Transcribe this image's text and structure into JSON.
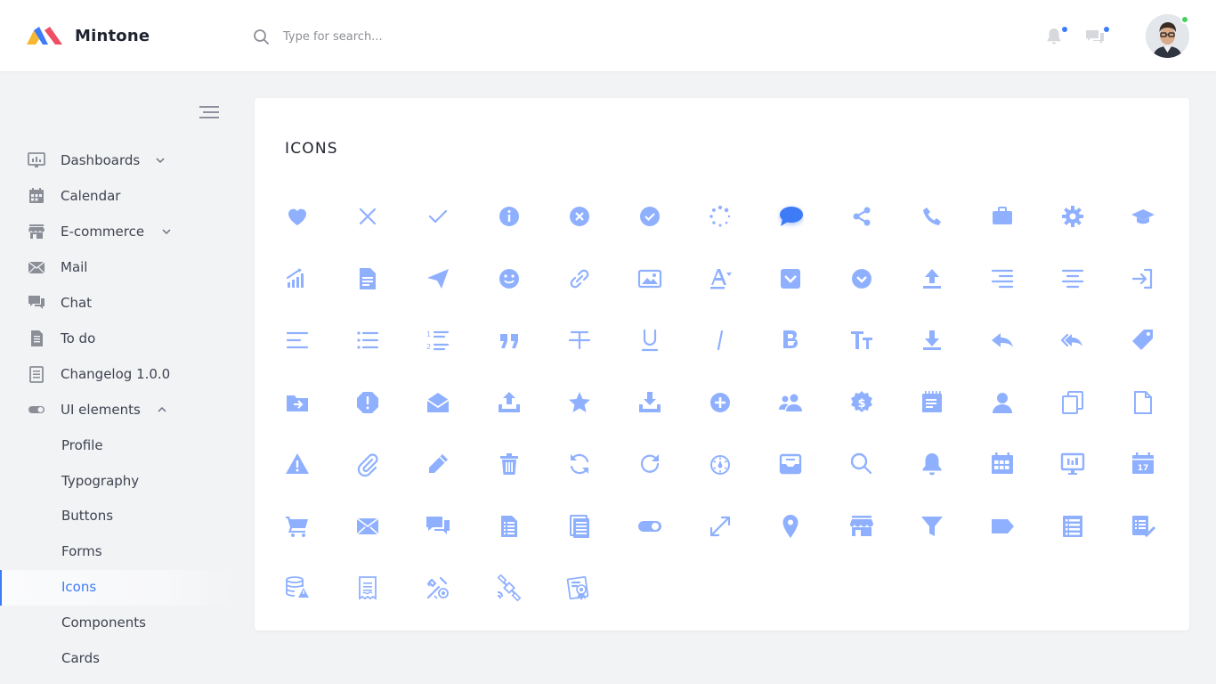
{
  "app": {
    "brand": "Mintone"
  },
  "search": {
    "placeholder": "Type for search..."
  },
  "colors": {
    "accent": "#3d7bf7",
    "icon_fill": "#8fb0ff",
    "icon_active": "#3d7bf7",
    "online": "#41d35a"
  },
  "sidebar": {
    "items": [
      {
        "label": "Dashboards",
        "icon": "dashboard-icon",
        "expandable": true
      },
      {
        "label": "Calendar",
        "icon": "calendar-icon"
      },
      {
        "label": "E-commerce",
        "icon": "store-icon",
        "expandable": true
      },
      {
        "label": "Mail",
        "icon": "mail-icon"
      },
      {
        "label": "Chat",
        "icon": "chat-icon"
      },
      {
        "label": "To do",
        "icon": "todo-icon"
      },
      {
        "label": "Changelog 1.0.0",
        "icon": "changelog-icon"
      },
      {
        "label": "UI elements",
        "icon": "toggle-icon",
        "expandable": true,
        "expanded": true
      }
    ],
    "sub_items": [
      {
        "label": "Profile"
      },
      {
        "label": "Typography"
      },
      {
        "label": "Buttons"
      },
      {
        "label": "Forms"
      },
      {
        "label": "Icons",
        "active": true
      },
      {
        "label": "Components"
      },
      {
        "label": "Cards"
      }
    ]
  },
  "main": {
    "title": "ICONS",
    "icons": [
      "heart-icon",
      "close-icon",
      "check-icon",
      "info-icon",
      "close-circle-icon",
      "check-circle-icon",
      "loading-icon",
      "comment-icon",
      "share-icon",
      "phone-icon",
      "briefcase-icon",
      "gear-icon",
      "graduation-cap-icon",
      "signal-icon",
      "document-icon",
      "send-icon",
      "smile-icon",
      "link-icon",
      "image-icon",
      "font-color-icon",
      "chevron-box-icon",
      "chevron-circle-icon",
      "upload-icon",
      "align-right-icon",
      "align-center-icon",
      "sign-in-icon",
      "align-left-icon",
      "list-icon",
      "ordered-list-icon",
      "quote-icon",
      "strikethrough-icon",
      "underline-icon",
      "italic-icon",
      "bold-icon",
      "text-size-icon",
      "download-icon",
      "reply-icon",
      "reply-all-icon",
      "tag-icon",
      "folder-move-icon",
      "alert-octagon-icon",
      "mail-open-icon",
      "tray-upload-icon",
      "star-icon",
      "tray-download-icon",
      "plus-circle-icon",
      "users-icon",
      "dollar-badge-icon",
      "notepad-icon",
      "user-icon",
      "copy-icon",
      "file-icon",
      "warning-icon",
      "paperclip-icon",
      "pencil-icon",
      "trash-icon",
      "refresh-icon",
      "redo-icon",
      "timer-icon",
      "inbox-icon",
      "search-icon",
      "bell-icon",
      "calendar-grid-icon",
      "presentation-icon",
      "calendar-day-icon",
      "cart-icon",
      "envelope-icon",
      "chat-icon",
      "document-list-icon",
      "book-icon",
      "toggle-icon",
      "expand-icon",
      "location-pin-icon",
      "store-icon",
      "filter-icon",
      "label-icon",
      "list-box-icon",
      "checklist-icon",
      "database-warning-icon",
      "invoice-icon",
      "tools-icon",
      "satellite-icon",
      "certificate-icon"
    ]
  }
}
